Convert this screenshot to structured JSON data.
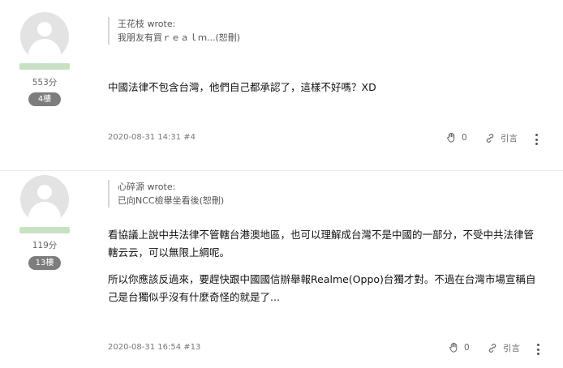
{
  "posts": [
    {
      "score": "553分",
      "floor_badge": "4樓",
      "quote": {
        "author": "王花枝 wrote:",
        "excerpt": "我朋友有買ｒｅａｌｍ...(恕刪)"
      },
      "paragraphs": [
        "中國法律不包含台灣，他們自己都承認了，這樣不好嗎？XD"
      ],
      "meta": "2020-08-31 14:31 #4",
      "like_count": "0",
      "quote_label": "引言",
      "icons": {
        "like": "hand-icon",
        "quote": "quote-link-icon",
        "more": "more-vertical-icon"
      }
    },
    {
      "score": "119分",
      "floor_badge": "13樓",
      "quote": {
        "author": "心碎源 wrote:",
        "excerpt": "已向NCC檢舉坐看後(恕刪)"
      },
      "paragraphs": [
        "看協議上說中共法律不管轄台港澳地區，也可以理解成台灣不是中國的一部分，不受中共法律管轄云云，可以無限上綱呢。",
        "所以你應該反過來，要趕快跟中國國信辦舉報Realme(Oppo)台獨才對。不過在台灣市場宣稱自己是台獨似乎沒有什麼奇怪的就是了..."
      ],
      "meta": "2020-08-31 16:54 #13",
      "like_count": "0",
      "quote_label": "引言",
      "icons": {
        "like": "hand-icon",
        "quote": "quote-link-icon",
        "more": "more-vertical-icon"
      }
    }
  ],
  "colors": {
    "level_bar": "#c7e2c3",
    "badge": "#7d7d7d",
    "avatar": "#e3e3e3"
  }
}
